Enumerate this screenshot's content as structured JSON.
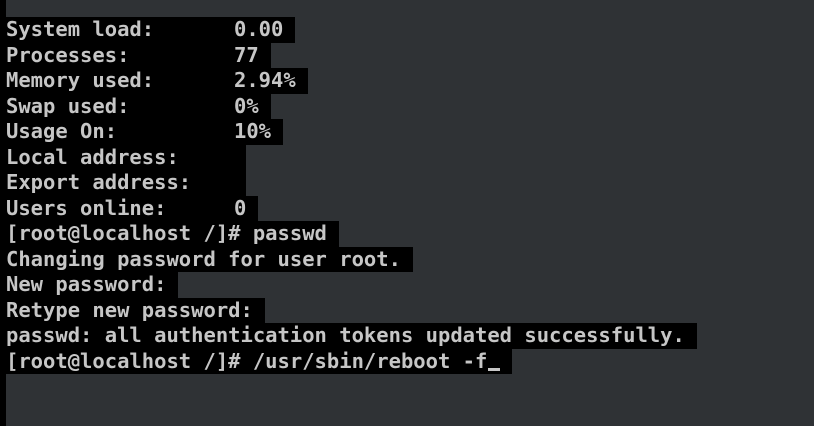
{
  "terminal": {
    "status": [
      {
        "label": "System load:",
        "value": "0.00"
      },
      {
        "label": "Processes:",
        "value": "77"
      },
      {
        "label": "Memory used:",
        "value": "2.94%"
      },
      {
        "label": "Swap used:",
        "value": "0%"
      },
      {
        "label": "Usage On:",
        "value": "10%"
      },
      {
        "label": "Local address:",
        "value": ""
      },
      {
        "label": "Export address:",
        "value": ""
      },
      {
        "label": "Users online:",
        "value": "0"
      }
    ],
    "output": [
      "[root@localhost /]# passwd",
      "Changing password for user root.",
      "New password:",
      "Retype new password:",
      "passwd: all authentication tokens updated successfully."
    ],
    "prompt": "[root@localhost /]# /usr/sbin/reboot -f"
  },
  "colors": {
    "background": "#2f3235",
    "text_background": "#000000",
    "text": "#c6c6c6"
  }
}
